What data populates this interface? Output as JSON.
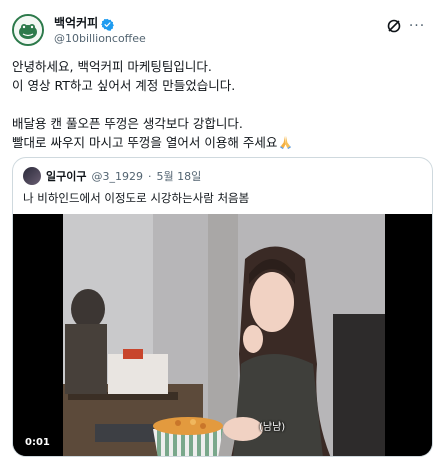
{
  "tweet": {
    "display_name": "백억커피",
    "handle": "@10billioncoffee",
    "lines": [
      "안녕하세요, 백억커피 마케팅팀입니다.",
      "이 영상 RT하고 싶어서 계정 만들었습니다.",
      "배달용 캔 풀오픈 뚜껑은 생각보다 강합니다.",
      "빨대로 싸우지 마시고 뚜껑을 열어서 이용해 주세요"
    ]
  },
  "icons": {
    "verified": "verified-badge-icon",
    "grok": "grok-icon",
    "more": "more-icon",
    "pray": "folded-hands-emoji"
  },
  "colors": {
    "verified": "#1d9bf0",
    "muted": "#536471",
    "border": "#cfd9de",
    "brand": "#2d7a4b"
  },
  "quote": {
    "name": "일구이구",
    "handle": "@3_1929",
    "separator": "·",
    "date": "5월 18일",
    "text": "나 비하인드에서 이정도로 시강하는사람 처음봄"
  },
  "video": {
    "time": "0:01",
    "caption": "(냠냠)"
  }
}
